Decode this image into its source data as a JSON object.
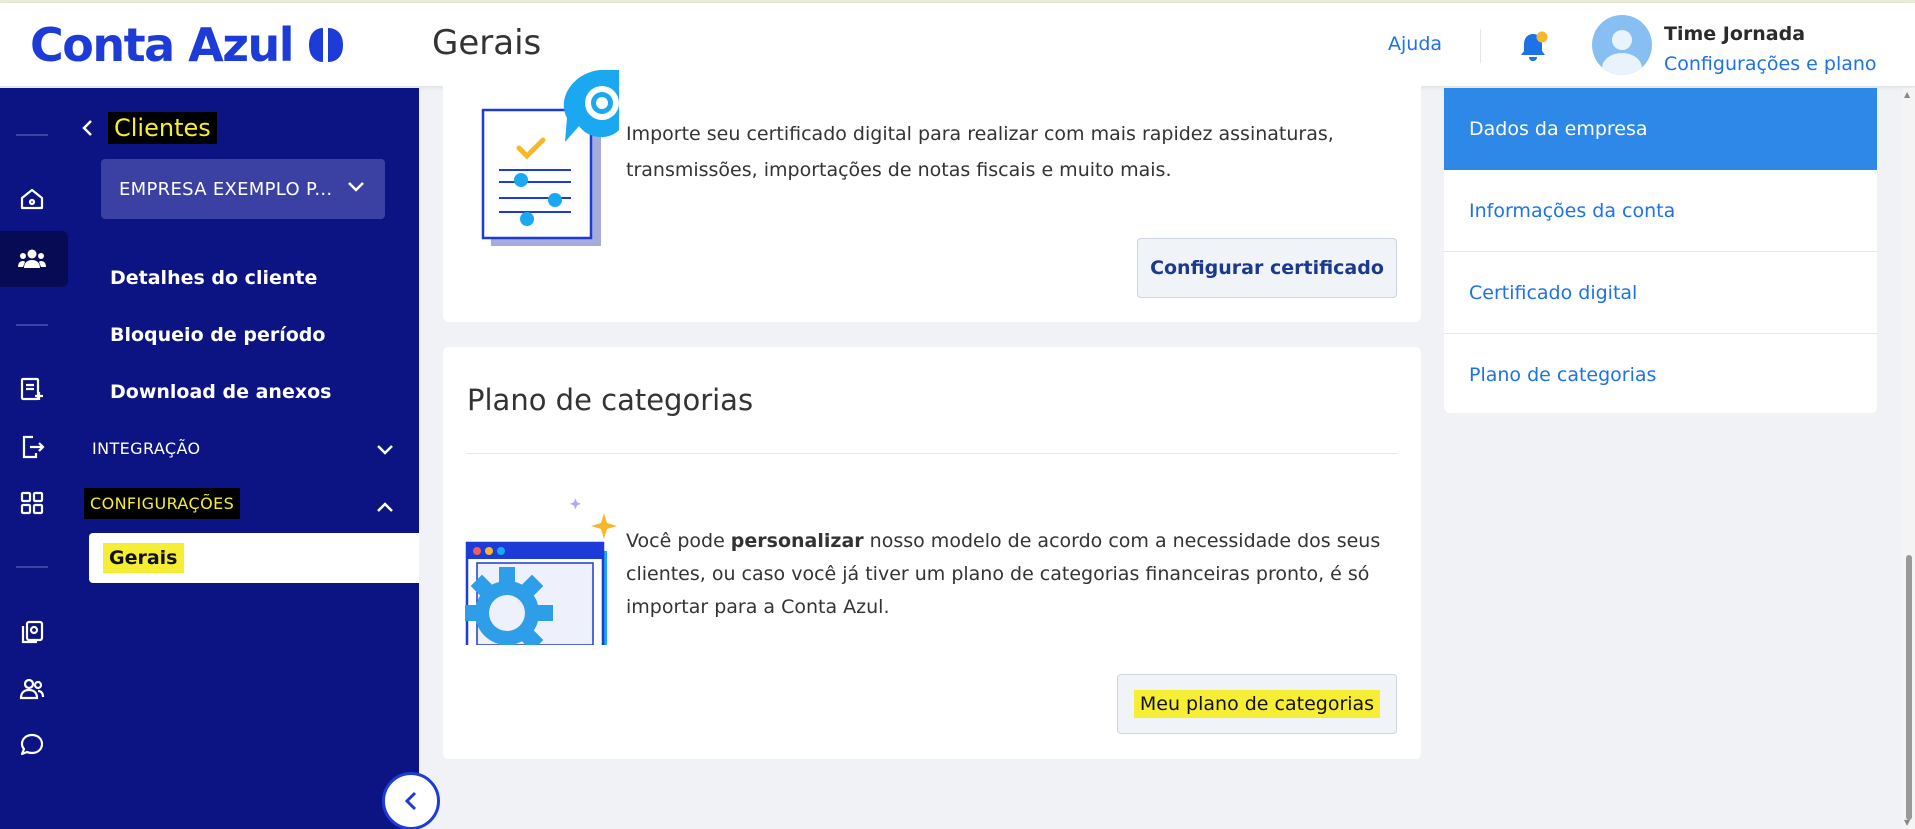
{
  "header": {
    "logo_text": "Conta Azul",
    "title": "Gerais",
    "help": "Ajuda",
    "user_name": "Time Jornada",
    "user_sub": "Configurações e plano"
  },
  "sidebar": {
    "back_label": "Clientes",
    "company": "EMPRESA EXEMPLO P...",
    "items": [
      {
        "label": "Detalhes do cliente"
      },
      {
        "label": "Bloqueio de período"
      },
      {
        "label": "Download de anexos"
      }
    ],
    "sections": [
      {
        "label": "INTEGRAÇÃO",
        "expanded": false
      },
      {
        "label": "CONFIGURAÇÕES",
        "expanded": true
      }
    ],
    "active_item": "Gerais"
  },
  "rail_icons": [
    "home-icon",
    "clients-icon",
    "invoice-add-icon",
    "export-icon",
    "apps-icon",
    "documents-icon",
    "users-icon",
    "chat-icon"
  ],
  "cert_card": {
    "text_line1": "Importe seu certificado digital para realizar com mais rapidez assinaturas,",
    "text_line2": "transmissões, importações de notas fiscais e muito mais.",
    "button": "Configurar certificado"
  },
  "categories_card": {
    "title": "Plano de categorias",
    "text_pre": "Você pode ",
    "text_bold": "personalizar",
    "text_line1_post": " nosso modelo de acordo com a necessidade dos seus",
    "text_line2": "clientes, ou caso você já tiver um plano de categorias financeiras pronto, é só",
    "text_line3": "importar para a Conta Azul.",
    "button": "Meu plano de categorias"
  },
  "right_nav": [
    {
      "label": "Dados da empresa",
      "active": true
    },
    {
      "label": "Informações da conta",
      "active": false
    },
    {
      "label": "Certificado digital",
      "active": false
    },
    {
      "label": "Plano de categorias",
      "active": false
    }
  ],
  "colors": {
    "brand": "#1d3bd6",
    "sidebar": "#0c1382",
    "link": "#1d72e8",
    "highlight": "#f5ee34"
  }
}
